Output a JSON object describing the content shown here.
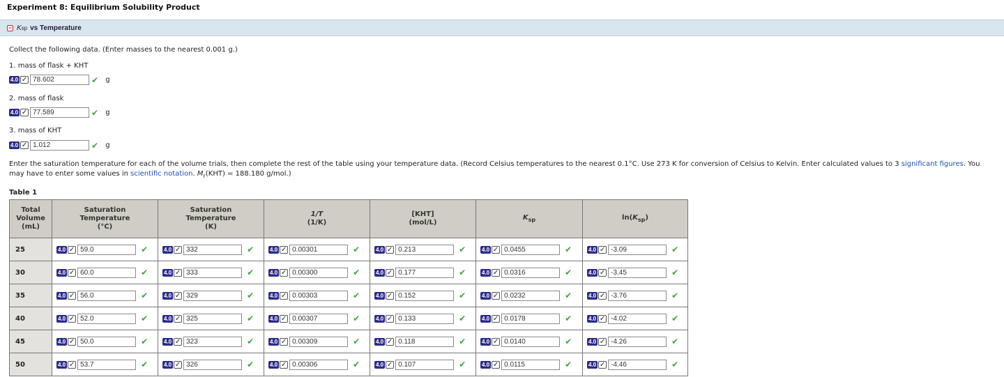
{
  "page_title": "Experiment 8: Equilibrium Solubility Product",
  "section": {
    "symbol": "K",
    "subscript": "sp",
    "rest": "vs Temperature"
  },
  "instructions": "Collect the following data. (Enter masses to the nearest 0.001 g.)",
  "badge_number": "4.0",
  "questions": [
    {
      "label": "1. mass of flask + KHT",
      "value": "78.602",
      "unit": "g"
    },
    {
      "label": "2. mass of flask",
      "value": "77.589",
      "unit": "g"
    },
    {
      "label": "3. mass of KHT",
      "value": "1.012",
      "unit": "g"
    }
  ],
  "paragraph": {
    "p1": "Enter the saturation temperature for each of the volume trials, then complete the rest of the table using your temperature data. (Record Celsius temperatures to the nearest 0.1°C. Use 273 K for conversion of Celsius to Kelvin. Enter calculated values to 3 ",
    "link1": "significant figures",
    "p2": ". You may have to enter some values in ",
    "link2": "scientific notation",
    "p3": ". ",
    "mr": "M",
    "mr_sub": "r",
    "p4": "(KHT) = 188.180 g/mol.)"
  },
  "table_caption": "Table 1",
  "headers": {
    "vol": [
      "Total",
      "Volume",
      "(mL)"
    ],
    "satc": [
      "Saturation",
      "Temperature",
      "(°C)"
    ],
    "satk": [
      "Saturation",
      "Temperature",
      "(K)"
    ],
    "invt": [
      "1/T",
      "(1/K)"
    ],
    "conc": [
      "[KHT]",
      "(mol/L)"
    ],
    "ksp": "K",
    "ksp_sub": "sp",
    "ln_pre": "ln(",
    "ln_k": "K",
    "ln_sub": "sp",
    "ln_post": ")"
  },
  "rows": [
    {
      "vol": "25",
      "c": "59.0",
      "k": "332",
      "inv": "0.00301",
      "kht": "0.213",
      "ksp": "0.0455",
      "ln": "-3.09"
    },
    {
      "vol": "30",
      "c": "60.0",
      "k": "333",
      "inv": "0.00300",
      "kht": "0.177",
      "ksp": "0.0316",
      "ln": "-3.45"
    },
    {
      "vol": "35",
      "c": "56.0",
      "k": "329",
      "inv": "0.00303",
      "kht": "0.152",
      "ksp": "0.0232",
      "ln": "-3.76"
    },
    {
      "vol": "40",
      "c": "52.0",
      "k": "325",
      "inv": "0.00307",
      "kht": "0.133",
      "ksp": "0.0178",
      "ln": "-4.02"
    },
    {
      "vol": "45",
      "c": "50.0",
      "k": "323",
      "inv": "0.00309",
      "kht": "0.118",
      "ksp": "0.0140",
      "ln": "-4.26"
    },
    {
      "vol": "50",
      "c": "53.7",
      "k": "326",
      "inv": "0.00306",
      "kht": "0.107",
      "ksp": "0.0115",
      "ln": "-4.46"
    }
  ]
}
